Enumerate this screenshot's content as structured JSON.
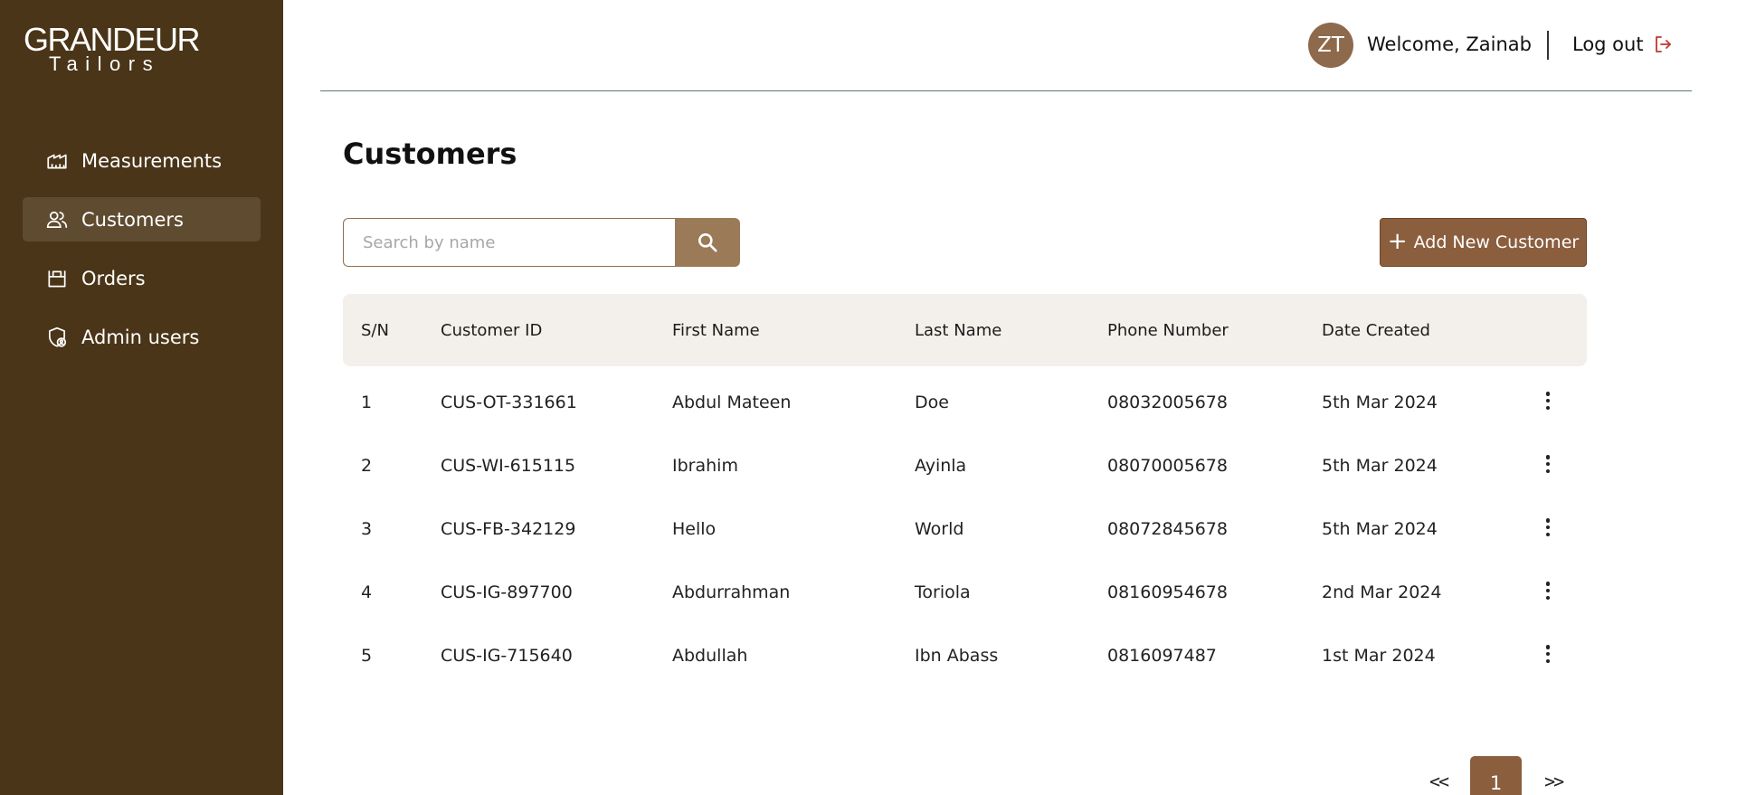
{
  "brand": {
    "name": "GRANDEUR",
    "subtitle": "Tailors"
  },
  "sidebar": {
    "items": [
      {
        "label": "Measurements",
        "icon": "ruler-icon",
        "active": false
      },
      {
        "label": "Customers",
        "icon": "users-icon",
        "active": true
      },
      {
        "label": "Orders",
        "icon": "basket-icon",
        "active": false
      },
      {
        "label": "Admin users",
        "icon": "shield-user-icon",
        "active": false
      }
    ]
  },
  "header": {
    "avatar_initials": "ZT",
    "welcome_text": "Welcome, Zainab",
    "logout_label": "Log out"
  },
  "main": {
    "title": "Customers",
    "search": {
      "placeholder": "Search by name",
      "value": ""
    },
    "add_button_label": "Add New Customer",
    "table": {
      "columns": [
        "S/N",
        "Customer ID",
        "First Name",
        "Last Name",
        "Phone Number",
        "Date Created"
      ],
      "rows": [
        [
          "1",
          "CUS-OT-331661",
          "Abdul Mateen",
          "Doe",
          "08032005678",
          "5th Mar 2024"
        ],
        [
          "2",
          "CUS-WI-615115",
          "Ibrahim",
          "Ayinla",
          "08070005678",
          "5th Mar 2024"
        ],
        [
          "3",
          "CUS-FB-342129",
          "Hello",
          "World",
          "08072845678",
          "5th Mar 2024"
        ],
        [
          "4",
          "CUS-IG-897700",
          "Abdurrahman",
          "Toriola",
          "08160954678",
          "2nd Mar 2024"
        ],
        [
          "5",
          "CUS-IG-715640",
          "Abdullah",
          "Ibn Abass",
          "0816097487",
          "1st Mar 2024"
        ]
      ]
    },
    "pagination": {
      "prev": "<<",
      "current": "1",
      "next": ">>"
    }
  },
  "colors": {
    "sidebar_bg": "#4a3518",
    "sidebar_active": "#5f4b30",
    "accent": "#8b5e3e",
    "search_button": "#9b7a58",
    "logout_icon": "#c0392b",
    "table_header_bg": "#f3f0eb"
  }
}
